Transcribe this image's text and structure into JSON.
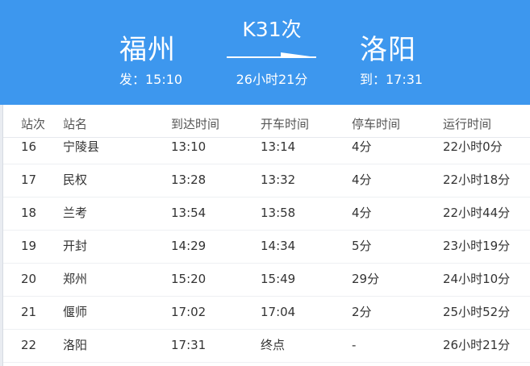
{
  "route": {
    "train_number": "K31次",
    "from_station": "福州",
    "from_time": "发：15:10",
    "to_station": "洛阳",
    "to_time": "到：17:31",
    "duration": "26小时21分"
  },
  "table": {
    "headers": [
      "站次",
      "站名",
      "到达时间",
      "开车时间",
      "停车时间",
      "运行时间"
    ],
    "rows": [
      [
        "16",
        "宁陵县",
        "13:10",
        "13:14",
        "4分",
        "22小时0分"
      ],
      [
        "17",
        "民权",
        "13:28",
        "13:32",
        "4分",
        "22小时18分"
      ],
      [
        "18",
        "兰考",
        "13:54",
        "13:58",
        "4分",
        "22小时44分"
      ],
      [
        "19",
        "开封",
        "14:29",
        "14:34",
        "5分",
        "23小时19分"
      ],
      [
        "20",
        "郑州",
        "15:20",
        "15:49",
        "29分",
        "24小时10分"
      ],
      [
        "21",
        "偃师",
        "17:02",
        "17:04",
        "2分",
        "25小时52分"
      ],
      [
        "22",
        "洛阳",
        "17:31",
        "终点",
        "-",
        "26小时21分"
      ]
    ]
  },
  "colors": {
    "header_bg": "#3d97ee",
    "header_text": "#ffffff",
    "row_text": "#333333"
  }
}
